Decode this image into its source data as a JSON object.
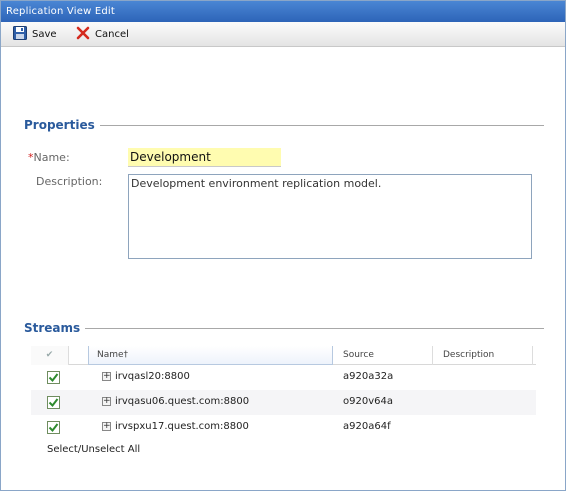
{
  "window": {
    "title": "Replication View Edit"
  },
  "toolbar": {
    "save_label": "Save",
    "cancel_label": "Cancel"
  },
  "properties": {
    "section_title": "Properties",
    "name_label": "Name:",
    "name_required_mark": "*",
    "name_value": "Development",
    "description_label": "Description:",
    "description_value": "Development environment replication model."
  },
  "streams": {
    "section_title": "Streams",
    "columns": {
      "check": "✔",
      "name": "Name†",
      "source": "Source",
      "description": "Description"
    },
    "rows": [
      {
        "checked": true,
        "name": "irvqasl20:8800",
        "source": "a920a32a",
        "description": ""
      },
      {
        "checked": true,
        "name": "irvqasu06.quest.com:8800",
        "source": "o920v64a",
        "description": ""
      },
      {
        "checked": true,
        "name": "irvspxu17.quest.com:8800",
        "source": "a920a64f",
        "description": ""
      }
    ],
    "expand_symbol": "+",
    "select_all_label": "Select/Unselect All"
  },
  "colors": {
    "titlebar": "#3a74c8",
    "section_title": "#2a5a9c",
    "required": "#d02020",
    "name_field_bg": "#fffcb0",
    "checkbox_check": "#2e8b2e"
  }
}
